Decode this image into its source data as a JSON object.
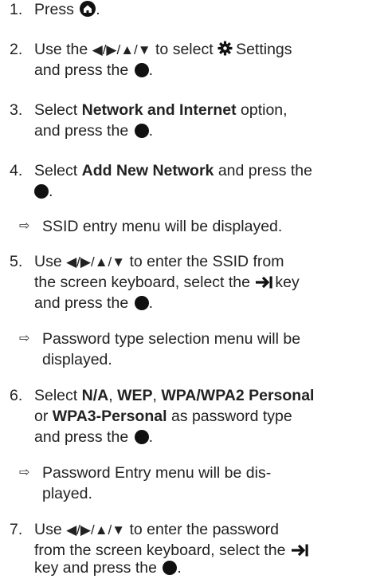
{
  "steps": {
    "s1": {
      "num": "1.",
      "a": "Press",
      "b": "."
    },
    "s2": {
      "num": "2.",
      "a": "Use the",
      "nav": "◀/▶/▲/▼",
      "b": "to select",
      "c": "Settings",
      "d": "and press the",
      "e": "."
    },
    "s3": {
      "num": "3.",
      "a": "Select",
      "bold": "Network and Internet",
      "b": "option,",
      "c": "and press the",
      "d": "."
    },
    "s4": {
      "num": "4.",
      "a": "Select",
      "bold": "Add New Network",
      "b": "and press the",
      "c": "."
    },
    "r1": {
      "text": "SSID entry menu will be displayed."
    },
    "s5": {
      "num": "5.",
      "a": "Use",
      "nav": "◀/▶/▲/▼",
      "b": "to enter the SSID from",
      "c": "the screen keyboard, select the",
      "d": "key",
      "e": "and press the",
      "f": "."
    },
    "r2": {
      "line1": "Password type selection menu will be",
      "line2": "displayed."
    },
    "s6": {
      "num": "6.",
      "a": "Select",
      "b1": "N/A",
      "sep1": ",",
      "b2": "WEP",
      "sep2": ",",
      "b3": "WPA/WPA2 Personal",
      "c": "or",
      "b4": "WPA3-Personal",
      "d": "as password type",
      "e": "and press the",
      "f": "."
    },
    "r3": {
      "line1": "Password Entry menu will be dis-",
      "line2": "played."
    },
    "s7": {
      "num": "7.",
      "a": "Use",
      "nav": "◀/▶/▲/▼",
      "b": "to enter the password",
      "c": "from the screen keyboard, select the",
      "d": "key and press the",
      "e": "."
    }
  },
  "icons": {
    "home": "home-button-icon",
    "settings": "gear-icon",
    "ok": "ok-button-icon",
    "tab": "tab-key-icon",
    "result": "result-arrow-icon"
  },
  "result_arrow": "⇨"
}
